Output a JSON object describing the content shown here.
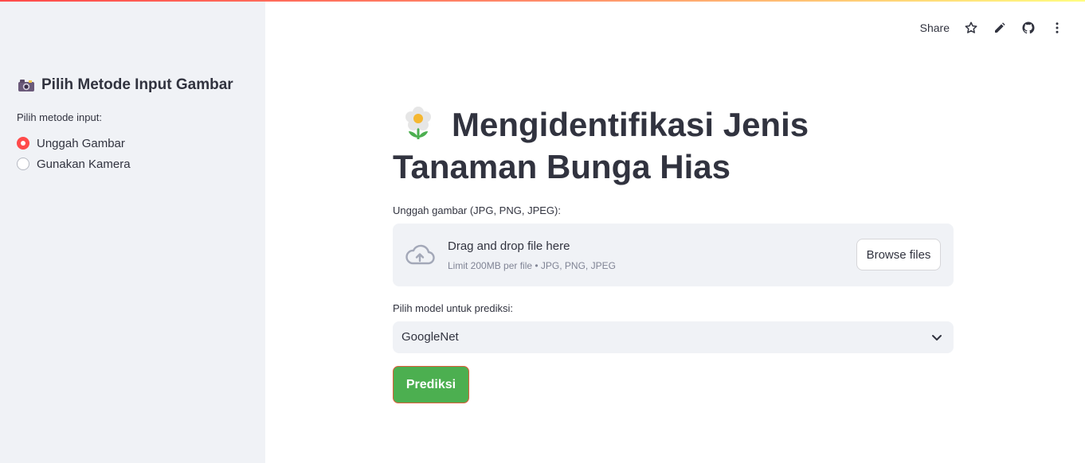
{
  "header": {
    "share_label": "Share",
    "icons": [
      "star-icon",
      "pencil-icon",
      "github-icon",
      "more-vertical-icon"
    ]
  },
  "sidebar": {
    "title": "Pilih Metode Input Gambar",
    "title_icon": "camera-icon",
    "radio_label": "Pilih metode input:",
    "options": [
      {
        "label": "Unggah Gambar",
        "selected": true
      },
      {
        "label": "Gunakan Kamera",
        "selected": false
      }
    ]
  },
  "main": {
    "title_icon": "flower-icon",
    "title": "Mengidentifikasi Jenis Tanaman Bunga Hias",
    "uploader": {
      "label": "Unggah gambar (JPG, PNG, JPEG):",
      "drop_text": "Drag and drop file here",
      "limit_text": "Limit 200MB per file • JPG, PNG, JPEG",
      "browse_label": "Browse files",
      "icon": "cloud-upload-icon"
    },
    "model_select": {
      "label": "Pilih model untuk prediksi:",
      "value": "GoogleNet"
    },
    "predict_label": "Prediksi"
  },
  "colors": {
    "accent": "#ff4b4b",
    "sidebar_bg": "#f0f2f6",
    "predict_button": "#4caf50",
    "text": "#31333f"
  }
}
